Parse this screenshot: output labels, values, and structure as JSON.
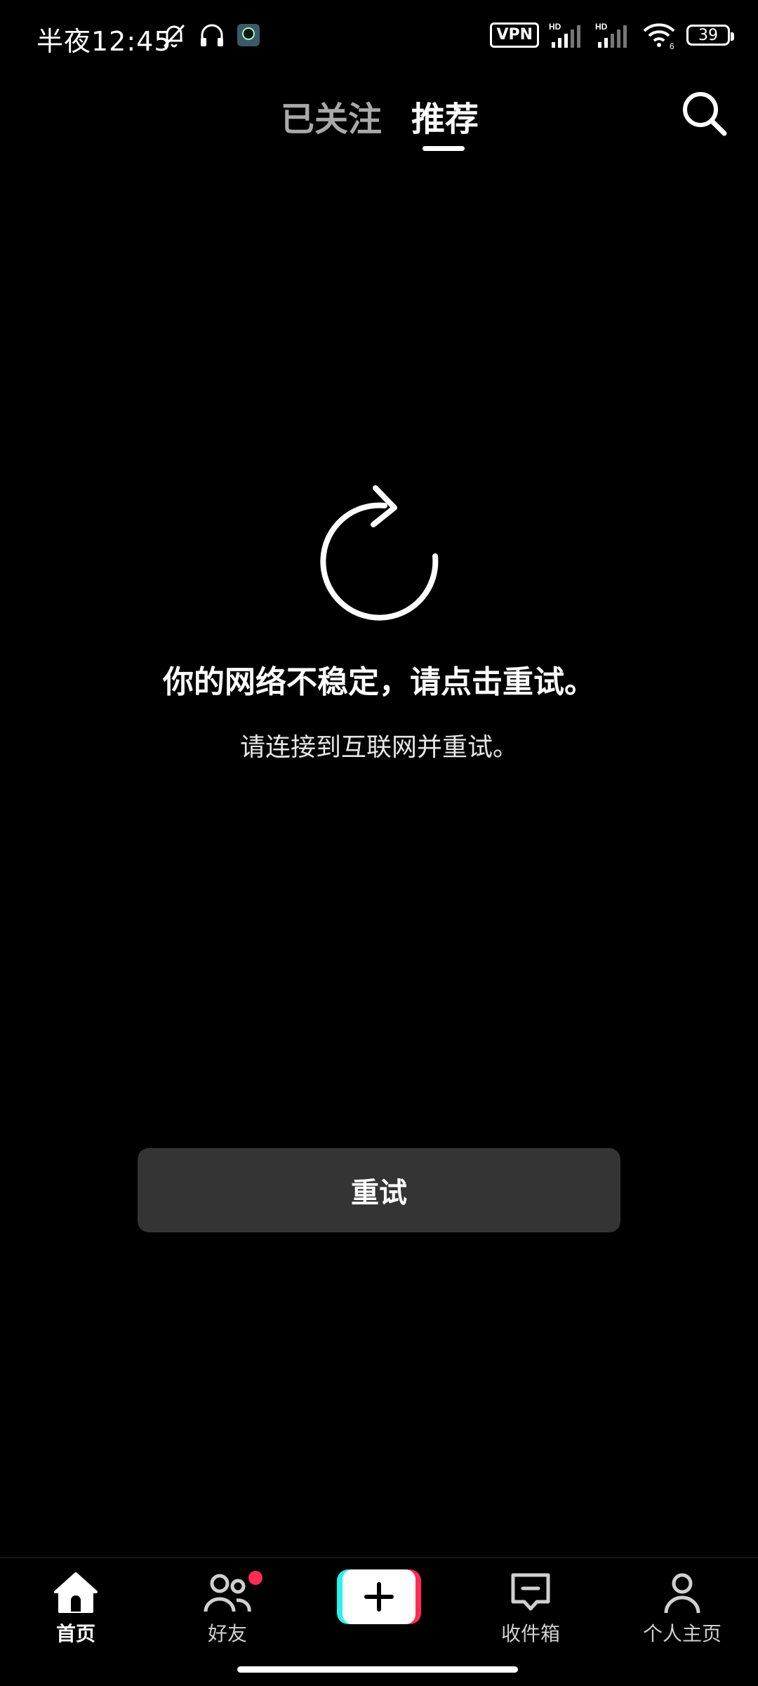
{
  "status_bar": {
    "time": "半夜12:45",
    "vpn": "VPN",
    "signal_1_label": "HD",
    "signal_2_label": "HD",
    "wifi_sub": "6",
    "battery": "39"
  },
  "top_tabs": {
    "following": "已关注",
    "recommend": "推荐",
    "active": "recommend"
  },
  "error": {
    "title": "你的网络不稳定，请点击重试。",
    "subtitle": "请连接到互联网并重试。",
    "retry_label": "重试"
  },
  "bottom_nav": {
    "home": "首页",
    "friends": "好友",
    "inbox": "收件箱",
    "profile": "个人主页"
  },
  "colors": {
    "background": "#000000",
    "button": "#343434",
    "accent_pink": "#fe2c55",
    "accent_cyan": "#25f4ee"
  }
}
